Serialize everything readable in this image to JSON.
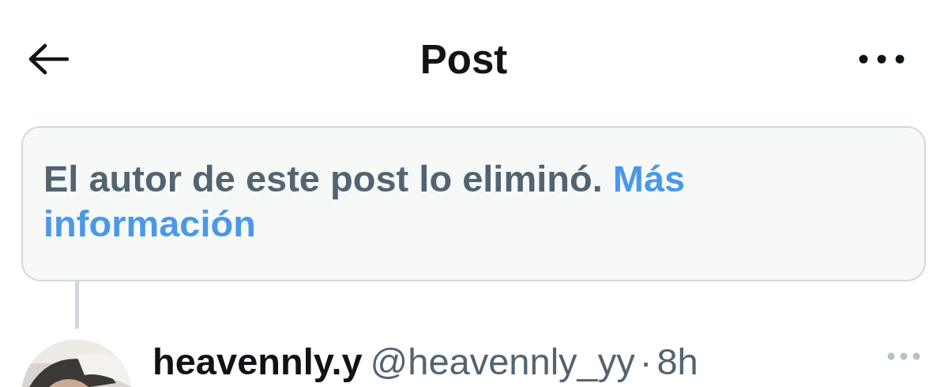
{
  "header": {
    "title": "Post"
  },
  "notice": {
    "text": "El autor de este post lo eliminó.",
    "link_lines": [
      "Más",
      "información"
    ]
  },
  "post": {
    "name": "heavennly.y",
    "handle": "@heavennly_yy",
    "separator": "·",
    "time": "8h"
  }
}
